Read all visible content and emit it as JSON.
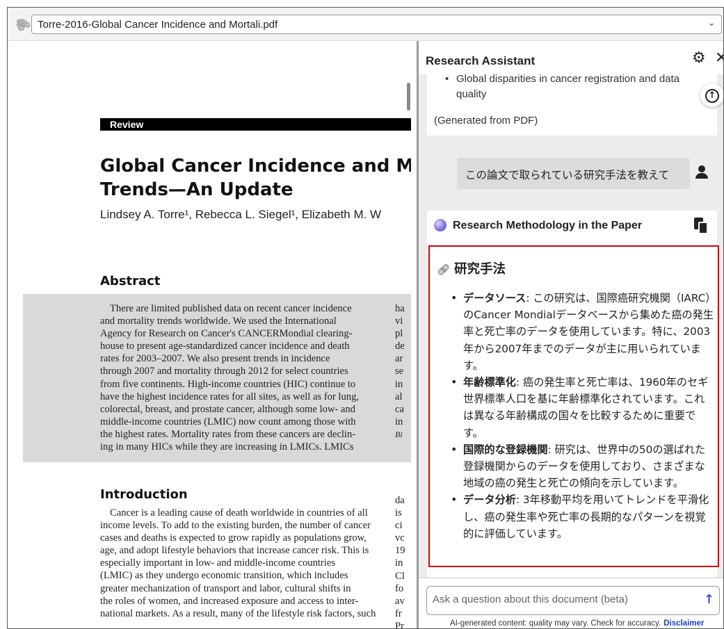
{
  "file_bar": {
    "filename": "Torre-2016-Global Cancer Incidence and Mortali.pdf"
  },
  "pdf": {
    "section_label": "Review",
    "title_line1": "Global Cancer Incidence and Mo",
    "title_line2": "Trends—An Update",
    "authors": "Lindsey A. Torre¹, Rebecca L. Siegel¹, Elizabeth M. W",
    "abstract_heading": "Abstract",
    "abstract_lines": [
      "There are limited published data on recent cancer incidence",
      "and mortality trends worldwide. We used the International",
      "Agency for Research on Cancer's CANCERMondial clearing-",
      "house to present age-standardized cancer incidence and death",
      "rates for 2003–2007. We also present trends in incidence",
      "through 2007 and mortality through 2012 for select countries",
      "from five continents. High-income countries (HIC) continue to",
      "have the highest incidence rates for all sites, as well as for lung,",
      "colorectal, breast, and prostate cancer, although some low- and",
      "middle-income countries (LMIC) now count among those with",
      "the highest rates. Mortality rates from these cancers are declin-",
      "ing in many HICs while they are increasing in LMICs. LMICs"
    ],
    "abstract_col2": [
      "ha",
      "vi",
      "pl",
      "de",
      "ar",
      "se",
      "in",
      "al",
      "ca",
      "in",
      "Bi"
    ],
    "intro_heading": "Introduction",
    "intro_lines": [
      "Cancer is a leading cause of death worldwide in countries of all",
      "income levels. To add to the existing burden, the number of cancer",
      "cases and deaths is expected to grow rapidly as populations grow,",
      "age, and adopt lifestyle behaviors that increase cancer risk. This is",
      "especially important in low- and middle-income countries",
      "(LMIC) as they undergo economic transition, which includes",
      "greater mechanization of transport and labor, cultural shifts in",
      "the roles of women, and increased exposure and access to inter-",
      "national markets. As a result, many of the lifestyle risk factors, such"
    ],
    "intro_col2": [
      "da",
      "is",
      "ci",
      "vc",
      "19",
      "in",
      "Cl",
      "fo",
      "av",
      "fr",
      "Pr"
    ]
  },
  "assistant": {
    "title": "Research Assistant",
    "previous_bullet": "Global disparities in cancer registration and data quality",
    "generated_note": "(Generated from PDF)",
    "user_question": "この論文で取られている研究手法を教えて",
    "answer_title": "Research Methodology in the Paper",
    "section_heading": "研究手法",
    "items": [
      {
        "term": "データソース",
        "text": ": この研究は、国際癌研究機関（IARC）のCancer Mondialデータベースから集めた癌の発生率と死亡率のデータを使用しています。特に、2003年から2007年までのデータが主に用いられています。"
      },
      {
        "term": "年齢標準化",
        "text": ": 癌の発生率と死亡率は、1960年のセギ世界標準人口を基に年齢標準化されています。これは異なる年齢構成の国々を比較するために重要です。"
      },
      {
        "term": "国際的な登録機関",
        "text": ": 研究は、世界中の50の選ばれた登録機関からのデータを使用しており、さまざまな地域の癌の発生と死亡の傾向を示しています。"
      },
      {
        "term": "データ分析",
        "text": ": 3年移動平均を用いてトレンドを平滑化し、癌の発生率や死亡率の長期的なパターンを視覚的に評価しています。"
      }
    ],
    "input_placeholder": "Ask a question about this document (beta)",
    "footnote": "AI-generated content: quality may vary. Check for accuracy.",
    "disclaimer_link": "Disclaimer"
  },
  "icons": {
    "attach": "paperclip-icon",
    "dropdown": "chevron-down-icon",
    "settings": "gear-icon",
    "close": "close-icon",
    "scroll_up": "scroll-up-icon",
    "user": "user-icon",
    "ai": "ai-sparkle-icon",
    "copy": "copy-icon",
    "link": "link-icon",
    "send": "send-arrow-icon"
  },
  "colors": {
    "highlight_box": "#d40000",
    "chat_background": "#ececec",
    "send_arrow": "#3b4ad8",
    "disclaimer_link": "#1a3fc8"
  }
}
